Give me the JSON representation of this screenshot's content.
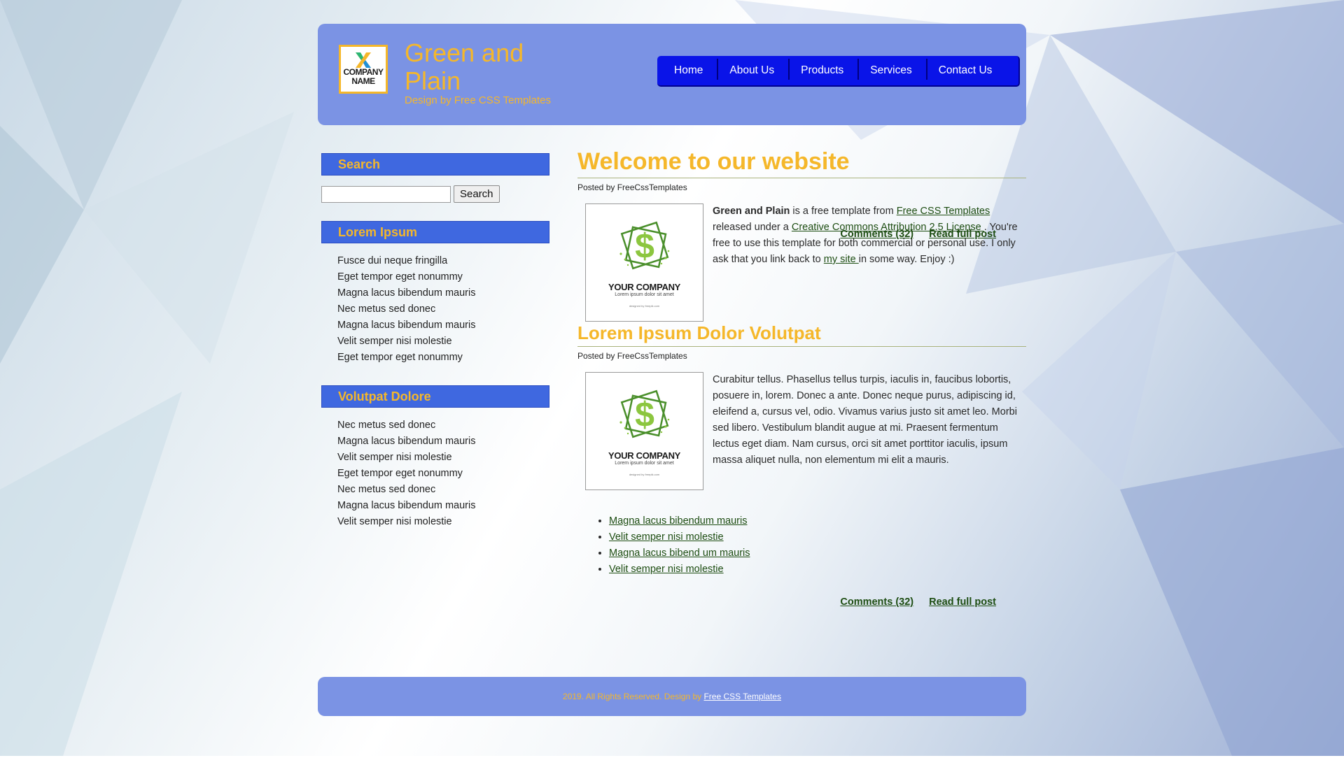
{
  "header": {
    "logo_text_line1": "COMPANY",
    "logo_text_line2": "NAME",
    "title": "Green and Plain",
    "subtitle": "Design by Free CSS Templates"
  },
  "nav": [
    "Home",
    "About Us",
    "Products",
    "Services",
    "Contact Us"
  ],
  "sidebar": {
    "search_heading": "Search",
    "search_input_value": "",
    "search_button": "Search",
    "section1_heading": "Lorem Ipsum",
    "section1_items": [
      "Fusce dui neque fringilla",
      "Eget tempor eget nonummy",
      "Magna lacus bibendum mauris",
      "Nec metus sed donec",
      "Magna lacus bibendum mauris",
      "Velit semper nisi molestie",
      "Eget tempor eget nonummy"
    ],
    "section2_heading": "Volutpat Dolore",
    "section2_items": [
      "Nec metus sed donec",
      "Magna lacus bibendum mauris",
      "Velit semper nisi molestie",
      "Eget tempor eget nonummy",
      "Nec metus sed donec",
      "Magna lacus bibendum mauris",
      "Velit semper nisi molestie"
    ]
  },
  "posts": [
    {
      "title": "Welcome to our website",
      "posted_by": "Posted by FreeCssTemplates",
      "thumb_company": "YOUR COMPANY",
      "thumb_tagline": "Lorem ipsum dolor sit amet",
      "thumb_credit": "designed by freepik.com",
      "text_strong": "Green and Plain",
      "text_1": " is a free template from ",
      "link_1": "Free CSS Templates",
      "text_2": " released under a ",
      "link_2": "Creative Commons Attribution 2.5 License ",
      "text_3": ". You're free to use this template for both commercial or personal use. I only ask that you link back to ",
      "link_3": "my site ",
      "text_4": "in some way. Enjoy :)",
      "comments": "Comments (32) ",
      "read_more": "Read full post"
    },
    {
      "title": "Lorem Ipsum Dolor Volutpat",
      "posted_by": "Posted by FreeCssTemplates",
      "thumb_company": "YOUR COMPANY",
      "thumb_tagline": "Lorem ipsum dolor sit amet",
      "thumb_credit": "designed by freepik.com",
      "text": "Curabitur tellus. Phasellus tellus turpis, iaculis in, faucibus lobortis, posuere in, lorem. Donec a ante. Donec neque purus, adipiscing id, eleifend a, cursus vel, odio. Vivamus varius justo sit amet leo. Morbi sed libero. Vestibulum blandit augue at mi. Praesent fermentum lectus eget diam. Nam cursus, orci sit amet porttitor iaculis, ipsum massa aliquet nulla, non elementum mi elit a mauris.",
      "bullets": [
        "Magna lacus bibendum mauris",
        "Velit semper nisi molestie",
        "Magna lacus bibend um mauris",
        "Velit semper nisi molestie"
      ],
      "comments": "Comments (32) ",
      "read_more": "Read full post"
    }
  ],
  "footer": {
    "text": "2019. All Rights Reserved. Design by ",
    "link": "Free CSS Templates "
  },
  "colors": {
    "accent_orange": "#f5b72a",
    "header_blue": "#7b93e4",
    "nav_blue": "#0a14e8",
    "sidebar_heading_blue": "#3f68e0",
    "link_green": "#1d4d12"
  }
}
